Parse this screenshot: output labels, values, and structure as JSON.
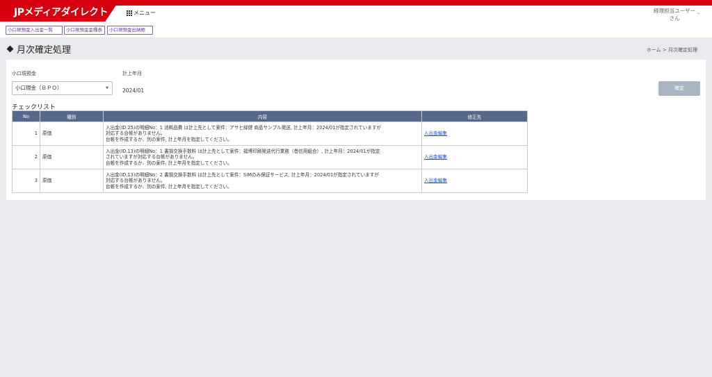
{
  "header": {
    "logo": "JPメディアダイレクト",
    "menu_label": "メニュー",
    "user_line1": "経理担当ユーザー",
    "user_line2": "さん"
  },
  "subnav": [
    "小口現預金入出金一覧",
    "小口現預金金種表",
    "小口現預金出納帳"
  ],
  "page": {
    "title": "月次確定処理",
    "breadcrumb": "ホーム >  月次確定処理"
  },
  "form": {
    "account_label": "小口現預金",
    "account_value": "小口現金（ＢＰＯ）",
    "month_label": "計上年月",
    "month_value": "2024/01",
    "confirm_label": "確定"
  },
  "checklist": {
    "title": "チェックリスト",
    "headers": [
      "No",
      "種別",
      "内容",
      "修正先"
    ],
    "rows": [
      {
        "no": "1",
        "kind": "原価",
        "lines": [
          "入出金(ID.25)の明細No：1 消耗品費 は計上先として案件：アサヒ緑健 商品サンプル発送, 計上年月：2024/01が指定されていますが",
          "対応する台帳がありません。",
          "台帳を作成するか、別の案件, 計上年月を指定してください。"
        ],
        "link": "入出金編集"
      },
      {
        "no": "2",
        "kind": "原価",
        "lines": [
          "入出金(ID.13)の明細No：1 書損交換手数料 は計上先として案件：福博印刷発送代行業務（巻信用組合）, 計上年月：2024/01が指定",
          "されていますが対応する台帳がありません。",
          "台帳を作成するか、別の案件, 計上年月を指定してください。"
        ],
        "link": "入出金編集"
      },
      {
        "no": "3",
        "kind": "原価",
        "lines": [
          "入出金(ID.13)の明細No：2 書損交換手数料 は計上先として案件：SIMのみ保証サービス, 計上年月：2024/01が指定されていますが",
          "対応する台帳がありません。",
          "台帳を作成するか、別の案件, 計上年月を指定してください。"
        ],
        "link": "入出金編集"
      }
    ]
  },
  "colors": {
    "brand_red": "#d7000f",
    "table_header": "#55688a",
    "link": "#1a55c8"
  }
}
